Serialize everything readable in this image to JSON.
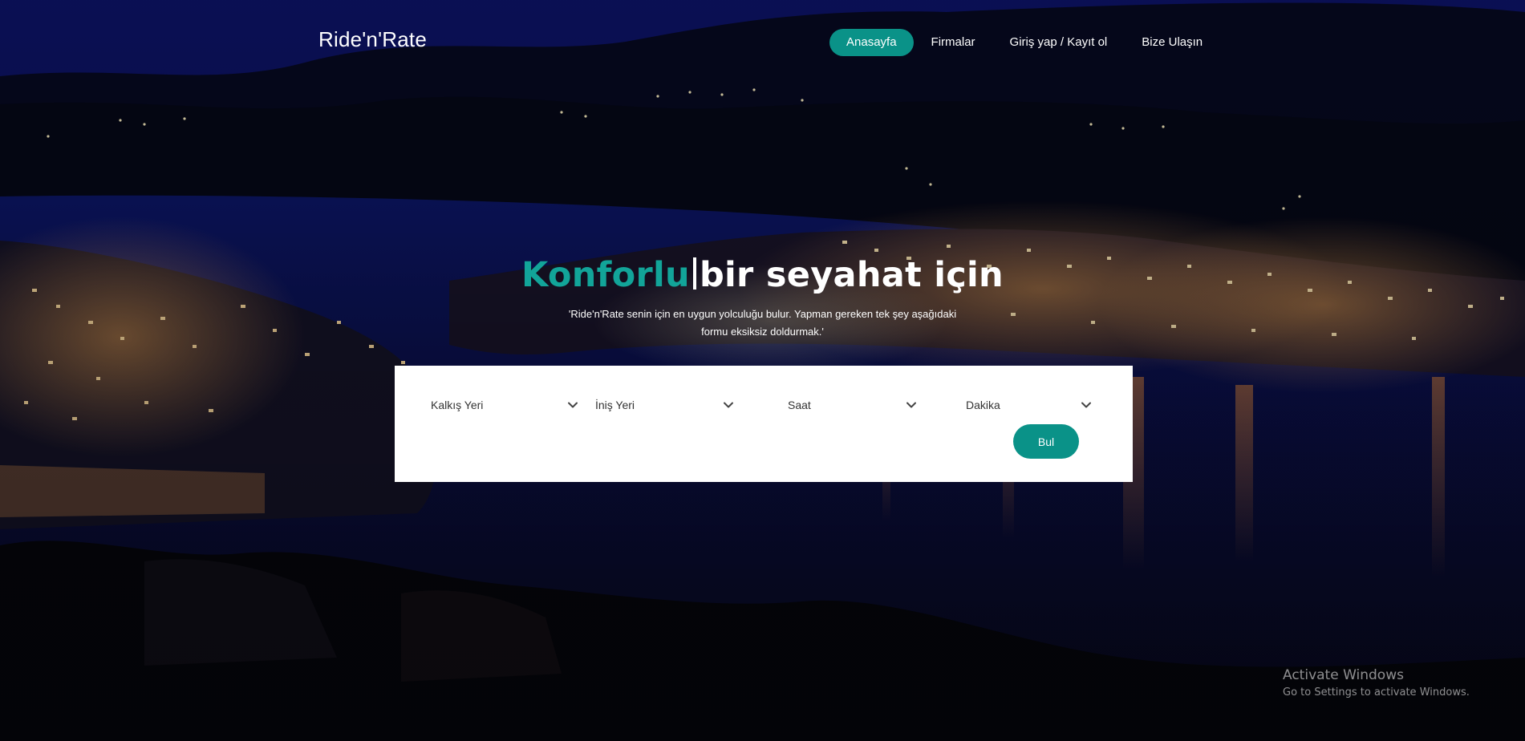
{
  "navbar": {
    "brand": "Ride'n'Rate",
    "items": [
      {
        "label": "Anasayfa",
        "active": true
      },
      {
        "label": "Firmalar",
        "active": false
      },
      {
        "label": "Giriş yap / Kayıt ol",
        "active": false
      },
      {
        "label": "Bize Ulaşın",
        "active": false
      }
    ]
  },
  "hero": {
    "title_accent": "Konforlu",
    "title_rest": "bir seyahat için",
    "subtitle_line1": "'Ride'n'Rate senin için en uygun yolculuğu bulur. Yapman gereken tek şey aşağıdaki",
    "subtitle_line2": "formu eksiksiz doldurmak.'"
  },
  "search": {
    "departure": {
      "value": "Kalkış Yeri"
    },
    "arrival": {
      "value": "İniş Yeri"
    },
    "hour": {
      "value": "Saat"
    },
    "minute": {
      "value": "Dakika"
    },
    "submit_label": "Bul"
  },
  "watermark": {
    "title": "Activate Windows",
    "subtitle": "Go to Settings to activate Windows."
  },
  "colors": {
    "accent": "#0a9288",
    "accent_text": "#12a499",
    "card_bg": "#ffffff"
  },
  "icons": {
    "select_arrow": "chevron-down-icon"
  }
}
